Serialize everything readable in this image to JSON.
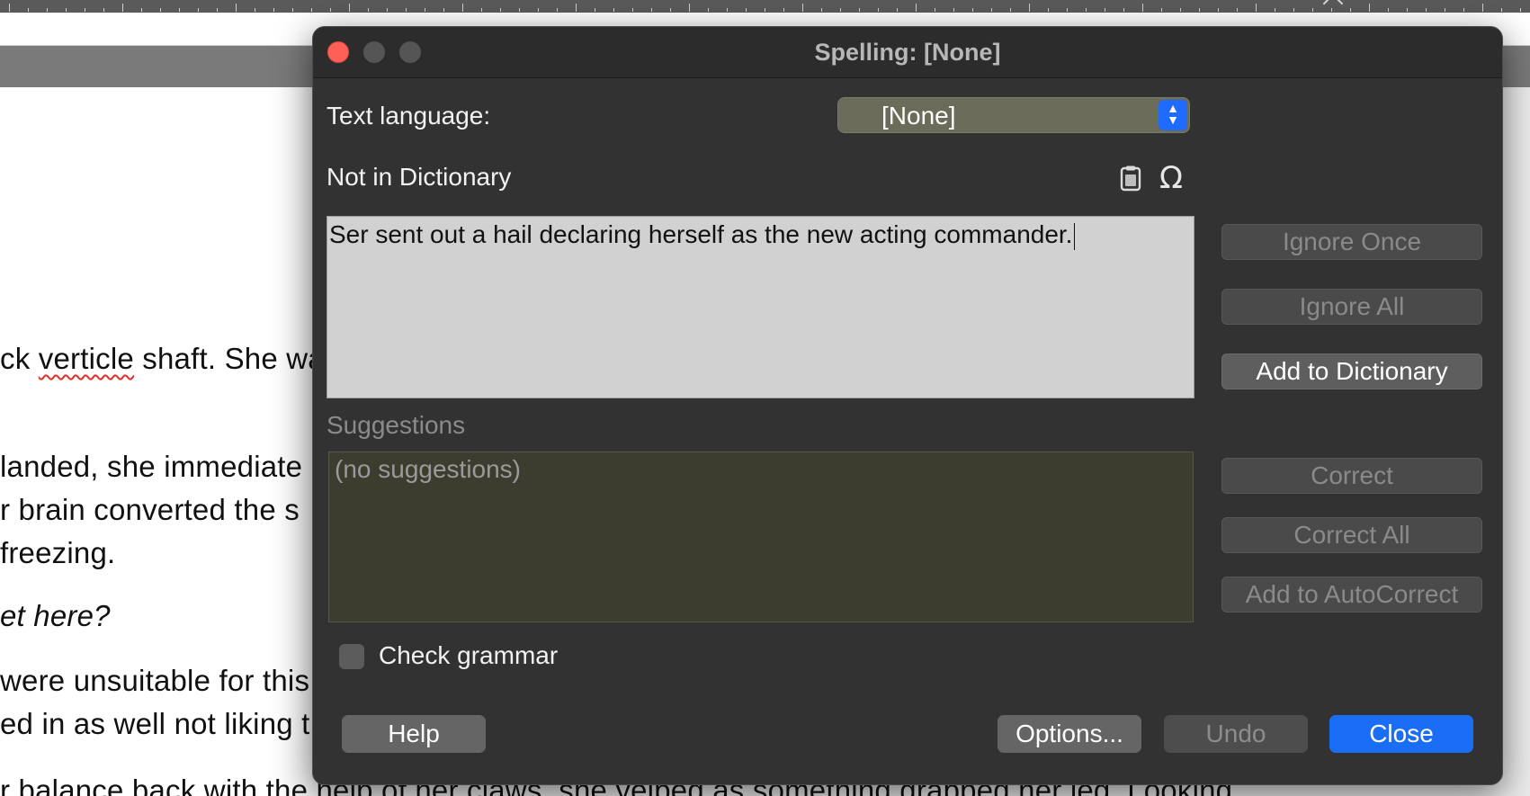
{
  "document": {
    "lines": [
      {
        "pre": "ck ",
        "misspelled": "verticle",
        "post": " shaft. She wa"
      },
      {
        "text": "landed, she immediate"
      },
      {
        "text": "r brain converted the s"
      },
      {
        "text": "freezing."
      },
      {
        "text": "et here?"
      },
      {
        "text": "were unsuitable for this"
      },
      {
        "text": "ed in as well not liking t"
      },
      {
        "text": "r balance back with the help of her claws, she yelped as something grabbed her leg. Looking"
      }
    ]
  },
  "dialog": {
    "title": "Spelling: [None]",
    "text_language_label": "Text language:",
    "text_language_value": "[None]",
    "not_in_dictionary_label": "Not in Dictionary",
    "sentence": "Ser sent out a hail declaring herself as the new acting commander.",
    "suggestions_label": "Suggestions",
    "suggestions_placeholder": "(no suggestions)",
    "buttons": {
      "ignore_once": "Ignore Once",
      "ignore_all": "Ignore All",
      "add_to_dictionary": "Add to Dictionary",
      "correct": "Correct",
      "correct_all": "Correct All",
      "add_to_autocorrect": "Add to AutoCorrect",
      "help": "Help",
      "options": "Options...",
      "undo": "Undo",
      "close": "Close"
    },
    "check_grammar_label": "Check grammar",
    "check_grammar_checked": false,
    "icons": {
      "paste": "clipboard-icon",
      "special_char": "omega-icon"
    },
    "colors": {
      "accent": "#1a6ef5",
      "close_light": "#fe5f57"
    }
  }
}
